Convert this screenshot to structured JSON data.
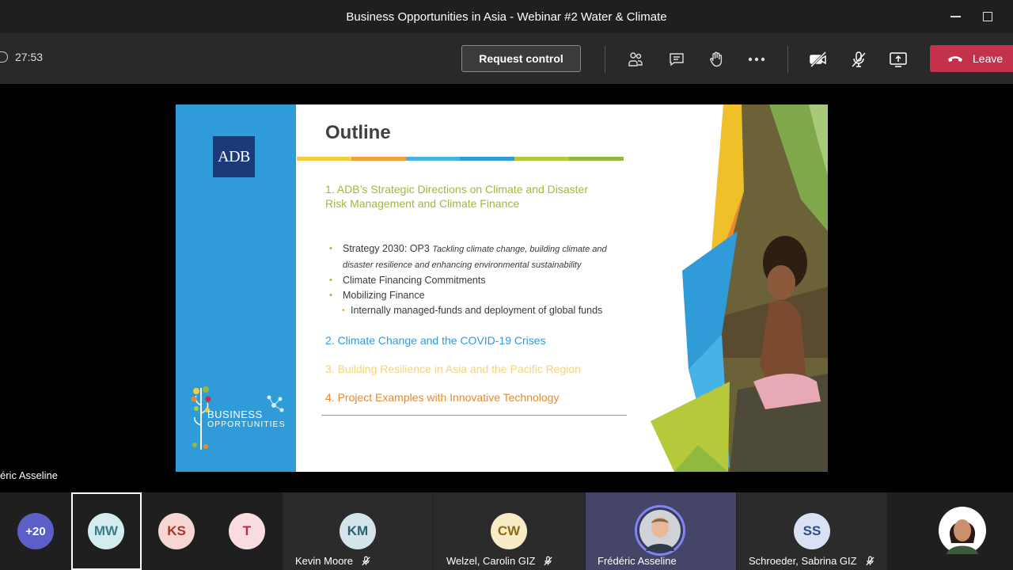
{
  "window": {
    "title": "Business Opportunities in Asia - Webinar #2 Water & Climate"
  },
  "toolbar": {
    "timer": "27:53",
    "request_control_label": "Request control",
    "leave_label": "Leave"
  },
  "stage": {
    "presenter_name": "éric Asseline"
  },
  "slide": {
    "logo_text": "ADB",
    "brand_line1": "BUSINESS",
    "brand_line2": "OPPORTUNITIES",
    "title": "Outline",
    "item1": "1. ADB’s Strategic Directions on Climate and Disaster Risk Management and Climate Finance",
    "bullet1_main": "Strategy 2030: OP3 ",
    "bullet1_italic": "Tackling climate change, building climate and disaster resilience and enhancing environmental sustainability",
    "bullet2": "Climate Financing Commitments",
    "bullet3": "Mobilizing Finance",
    "bullet3_sub": "Internally managed-funds and deployment of global funds",
    "item2": "2. Climate Change and the COVID-19 Crises",
    "item3": "3. Building Resilience in Asia and the Pacific Region",
    "item4": "4. Project Examples with Innovative Technology",
    "bar_colors": [
      "#f2cf3b",
      "#f0a23a",
      "#47b2e5",
      "#2f9bd8",
      "#b5c93a",
      "#8fba3f"
    ]
  },
  "participants": {
    "overflow": "+20",
    "tiles": [
      {
        "initials": "MW",
        "name": "",
        "mic_off": false
      },
      {
        "initials": "KS",
        "name": "",
        "mic_off": false
      },
      {
        "initials": "T",
        "name": "",
        "mic_off": false
      },
      {
        "initials": "KM",
        "name": "Kevin Moore",
        "mic_off": true
      },
      {
        "initials": "CW",
        "name": "Welzel, Carolin GIZ",
        "mic_off": true
      },
      {
        "initials": "",
        "name": "Frédéric Asseline",
        "mic_off": false
      },
      {
        "initials": "SS",
        "name": "Schroeder, Sabrina GIZ",
        "mic_off": true
      }
    ]
  },
  "colors": {
    "leave": "#c4314b",
    "speaking_ring": "#7f85f5"
  }
}
